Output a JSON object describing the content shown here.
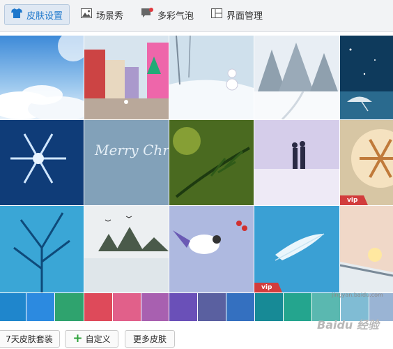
{
  "toolbar": {
    "tabs": [
      {
        "label": "皮肤设置",
        "icon": "shirt-icon",
        "active": true
      },
      {
        "label": "场景秀",
        "icon": "picture-icon",
        "active": false
      },
      {
        "label": "多彩气泡",
        "icon": "chat-bubble-icon",
        "active": false
      },
      {
        "label": "界面管理",
        "icon": "layout-icon",
        "active": false
      }
    ]
  },
  "skins": [
    {
      "theme": "sky-clouds"
    },
    {
      "theme": "christmas-street"
    },
    {
      "theme": "snowman"
    },
    {
      "theme": "snowy-forest"
    },
    {
      "theme": "umbrella-night"
    },
    {
      "theme": "snowflake"
    },
    {
      "theme": "merry-christmas",
      "text": "Merry Christmas"
    },
    {
      "theme": "pine-branch"
    },
    {
      "theme": "couple-walk"
    },
    {
      "theme": "latte-art",
      "vip": "vip"
    },
    {
      "theme": "frozen-tree"
    },
    {
      "theme": "winter-lake"
    },
    {
      "theme": "winter-bird"
    },
    {
      "theme": "feather",
      "vip": "vip"
    },
    {
      "theme": "snowy-bridge"
    }
  ],
  "colors": [
    "#1f86cc",
    "#2c8ae0",
    "#2fa36e",
    "#de4a5a",
    "#e1608a",
    "#a860b0",
    "#6a50b8",
    "#5a60a0",
    "#3470c0",
    "#178a96",
    "#24a58e",
    "#5ab8b0",
    "#80bcd4",
    "#9ab4d4"
  ],
  "footer": {
    "package_label": "7天皮肤套装",
    "custom_label": "自定义",
    "more_label": "更多皮肤"
  },
  "watermark": {
    "brand": "Baidu 经验",
    "url": "jingyan.baidu.com"
  }
}
